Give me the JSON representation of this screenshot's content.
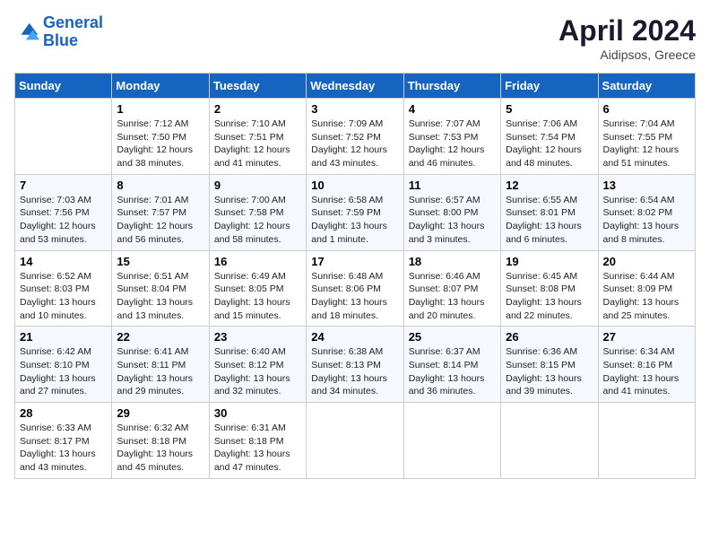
{
  "header": {
    "logo_line1": "General",
    "logo_line2": "Blue",
    "month": "April 2024",
    "location": "Aidipsos, Greece"
  },
  "weekdays": [
    "Sunday",
    "Monday",
    "Tuesday",
    "Wednesday",
    "Thursday",
    "Friday",
    "Saturday"
  ],
  "weeks": [
    [
      {
        "day": "",
        "sunrise": "",
        "sunset": "",
        "daylight": ""
      },
      {
        "day": "1",
        "sunrise": "Sunrise: 7:12 AM",
        "sunset": "Sunset: 7:50 PM",
        "daylight": "Daylight: 12 hours and 38 minutes."
      },
      {
        "day": "2",
        "sunrise": "Sunrise: 7:10 AM",
        "sunset": "Sunset: 7:51 PM",
        "daylight": "Daylight: 12 hours and 41 minutes."
      },
      {
        "day": "3",
        "sunrise": "Sunrise: 7:09 AM",
        "sunset": "Sunset: 7:52 PM",
        "daylight": "Daylight: 12 hours and 43 minutes."
      },
      {
        "day": "4",
        "sunrise": "Sunrise: 7:07 AM",
        "sunset": "Sunset: 7:53 PM",
        "daylight": "Daylight: 12 hours and 46 minutes."
      },
      {
        "day": "5",
        "sunrise": "Sunrise: 7:06 AM",
        "sunset": "Sunset: 7:54 PM",
        "daylight": "Daylight: 12 hours and 48 minutes."
      },
      {
        "day": "6",
        "sunrise": "Sunrise: 7:04 AM",
        "sunset": "Sunset: 7:55 PM",
        "daylight": "Daylight: 12 hours and 51 minutes."
      }
    ],
    [
      {
        "day": "7",
        "sunrise": "Sunrise: 7:03 AM",
        "sunset": "Sunset: 7:56 PM",
        "daylight": "Daylight: 12 hours and 53 minutes."
      },
      {
        "day": "8",
        "sunrise": "Sunrise: 7:01 AM",
        "sunset": "Sunset: 7:57 PM",
        "daylight": "Daylight: 12 hours and 56 minutes."
      },
      {
        "day": "9",
        "sunrise": "Sunrise: 7:00 AM",
        "sunset": "Sunset: 7:58 PM",
        "daylight": "Daylight: 12 hours and 58 minutes."
      },
      {
        "day": "10",
        "sunrise": "Sunrise: 6:58 AM",
        "sunset": "Sunset: 7:59 PM",
        "daylight": "Daylight: 13 hours and 1 minute."
      },
      {
        "day": "11",
        "sunrise": "Sunrise: 6:57 AM",
        "sunset": "Sunset: 8:00 PM",
        "daylight": "Daylight: 13 hours and 3 minutes."
      },
      {
        "day": "12",
        "sunrise": "Sunrise: 6:55 AM",
        "sunset": "Sunset: 8:01 PM",
        "daylight": "Daylight: 13 hours and 6 minutes."
      },
      {
        "day": "13",
        "sunrise": "Sunrise: 6:54 AM",
        "sunset": "Sunset: 8:02 PM",
        "daylight": "Daylight: 13 hours and 8 minutes."
      }
    ],
    [
      {
        "day": "14",
        "sunrise": "Sunrise: 6:52 AM",
        "sunset": "Sunset: 8:03 PM",
        "daylight": "Daylight: 13 hours and 10 minutes."
      },
      {
        "day": "15",
        "sunrise": "Sunrise: 6:51 AM",
        "sunset": "Sunset: 8:04 PM",
        "daylight": "Daylight: 13 hours and 13 minutes."
      },
      {
        "day": "16",
        "sunrise": "Sunrise: 6:49 AM",
        "sunset": "Sunset: 8:05 PM",
        "daylight": "Daylight: 13 hours and 15 minutes."
      },
      {
        "day": "17",
        "sunrise": "Sunrise: 6:48 AM",
        "sunset": "Sunset: 8:06 PM",
        "daylight": "Daylight: 13 hours and 18 minutes."
      },
      {
        "day": "18",
        "sunrise": "Sunrise: 6:46 AM",
        "sunset": "Sunset: 8:07 PM",
        "daylight": "Daylight: 13 hours and 20 minutes."
      },
      {
        "day": "19",
        "sunrise": "Sunrise: 6:45 AM",
        "sunset": "Sunset: 8:08 PM",
        "daylight": "Daylight: 13 hours and 22 minutes."
      },
      {
        "day": "20",
        "sunrise": "Sunrise: 6:44 AM",
        "sunset": "Sunset: 8:09 PM",
        "daylight": "Daylight: 13 hours and 25 minutes."
      }
    ],
    [
      {
        "day": "21",
        "sunrise": "Sunrise: 6:42 AM",
        "sunset": "Sunset: 8:10 PM",
        "daylight": "Daylight: 13 hours and 27 minutes."
      },
      {
        "day": "22",
        "sunrise": "Sunrise: 6:41 AM",
        "sunset": "Sunset: 8:11 PM",
        "daylight": "Daylight: 13 hours and 29 minutes."
      },
      {
        "day": "23",
        "sunrise": "Sunrise: 6:40 AM",
        "sunset": "Sunset: 8:12 PM",
        "daylight": "Daylight: 13 hours and 32 minutes."
      },
      {
        "day": "24",
        "sunrise": "Sunrise: 6:38 AM",
        "sunset": "Sunset: 8:13 PM",
        "daylight": "Daylight: 13 hours and 34 minutes."
      },
      {
        "day": "25",
        "sunrise": "Sunrise: 6:37 AM",
        "sunset": "Sunset: 8:14 PM",
        "daylight": "Daylight: 13 hours and 36 minutes."
      },
      {
        "day": "26",
        "sunrise": "Sunrise: 6:36 AM",
        "sunset": "Sunset: 8:15 PM",
        "daylight": "Daylight: 13 hours and 39 minutes."
      },
      {
        "day": "27",
        "sunrise": "Sunrise: 6:34 AM",
        "sunset": "Sunset: 8:16 PM",
        "daylight": "Daylight: 13 hours and 41 minutes."
      }
    ],
    [
      {
        "day": "28",
        "sunrise": "Sunrise: 6:33 AM",
        "sunset": "Sunset: 8:17 PM",
        "daylight": "Daylight: 13 hours and 43 minutes."
      },
      {
        "day": "29",
        "sunrise": "Sunrise: 6:32 AM",
        "sunset": "Sunset: 8:18 PM",
        "daylight": "Daylight: 13 hours and 45 minutes."
      },
      {
        "day": "30",
        "sunrise": "Sunrise: 6:31 AM",
        "sunset": "Sunset: 8:18 PM",
        "daylight": "Daylight: 13 hours and 47 minutes."
      },
      {
        "day": "",
        "sunrise": "",
        "sunset": "",
        "daylight": ""
      },
      {
        "day": "",
        "sunrise": "",
        "sunset": "",
        "daylight": ""
      },
      {
        "day": "",
        "sunrise": "",
        "sunset": "",
        "daylight": ""
      },
      {
        "day": "",
        "sunrise": "",
        "sunset": "",
        "daylight": ""
      }
    ]
  ]
}
